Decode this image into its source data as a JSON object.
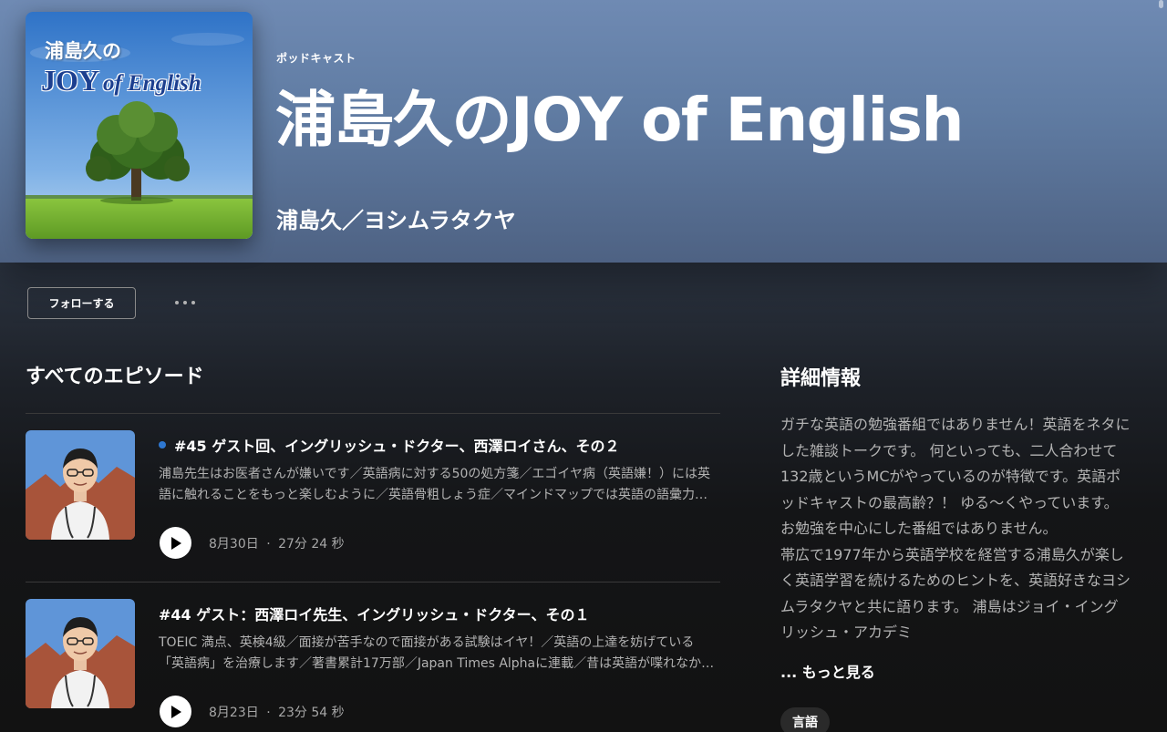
{
  "header": {
    "type_label": "ポッドキャスト",
    "title": "浦島久のJOY of English",
    "author": "浦島久／ヨシムラタクヤ",
    "cover": {
      "line1": "浦島久の",
      "line2_big": "JOY",
      "line2_rest": "of English"
    }
  },
  "actions": {
    "follow_label": "フォローする",
    "more_icon": "more-dots-icon"
  },
  "episodes_section": {
    "title": "すべてのエピソード",
    "episodes": [
      {
        "is_new": true,
        "title": "#45 ゲスト回、イングリッシュ・ドクター、西澤ロイさん、その２",
        "description": "浦島先生はお医者さんが嫌いです／英語病に対する50の処方箋／エゴイヤ病（英語嫌！）には英語に触れることをもっと楽しむように／英語骨粗しょう症／マインドマップでは英語の語彙力アップ",
        "date": "8月30日",
        "separator": "·",
        "duration": "27分 24 秒"
      },
      {
        "is_new": false,
        "title": "#44 ゲスト：西澤ロイ先生、イングリッシュ・ドクター、その１",
        "description": "TOEIC 満点、英検4級／面接が苦手なので面接がある試験はイヤ！／英語の上達を妨げている「英語病」を治療します／著書累計17万部／Japan Times Alphaに連載／昔は英語が喋れなかった",
        "date": "8月23日",
        "separator": "·",
        "duration": "23分 54 秒"
      }
    ]
  },
  "about": {
    "title": "詳細情報",
    "text": "ガチな英語の勉強番組ではありません！英語をネタにした雑談トークです。 何といっても、二人合わせて132歳というMCがやっているのが特徴です。英語ポッドキャストの最高齢？！ ゆる〜くやっています。お勉強を中心にした番組ではありません。\n帯広で1977年から英語学校を経営する浦島久が楽しく英語学習を続けるためのヒントを、英語好きなヨシムラタクヤと共に語ります。 浦島はジョイ・イングリッシュ・アカデミ",
    "see_more": "... もっと見る",
    "tag": "言語"
  },
  "colors": {
    "hero_top": "#6f8ab3",
    "background": "#121212",
    "new_dot": "#2e77d0",
    "muted_text": "#b3b3b3"
  }
}
